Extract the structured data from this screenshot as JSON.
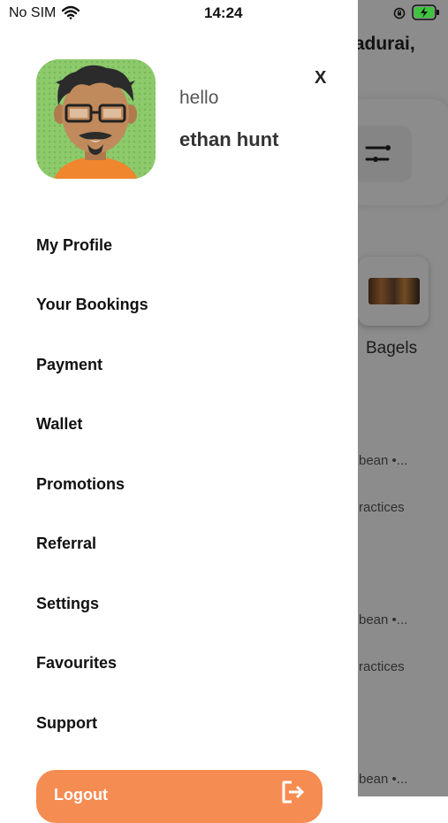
{
  "status_bar": {
    "carrier": "No SIM",
    "time": "14:24",
    "battery_color": "#3ec43e"
  },
  "background": {
    "greeting": "ladurai,",
    "category_label": "Bagels",
    "list_texts": [
      "bean •...",
      "ractices",
      "bean •...",
      "ractices",
      "bean •..."
    ]
  },
  "drawer": {
    "greeting": "hello",
    "user_name": "ethan hunt",
    "close_label": "X",
    "menu": [
      "My Profile",
      "Your Bookings",
      "Payment",
      "Wallet",
      "Promotions",
      "Referral",
      "Settings",
      "Favourites",
      "Support"
    ],
    "logout_label": "Logout",
    "logout_color": "#f58c52"
  },
  "icons": {
    "wifi": "wifi-icon",
    "lock_rotation": "rotation-lock-icon",
    "battery": "battery-charging-icon",
    "close": "close-icon",
    "filter": "filter-icon",
    "logout": "logout-icon",
    "avatar": "avatar"
  }
}
